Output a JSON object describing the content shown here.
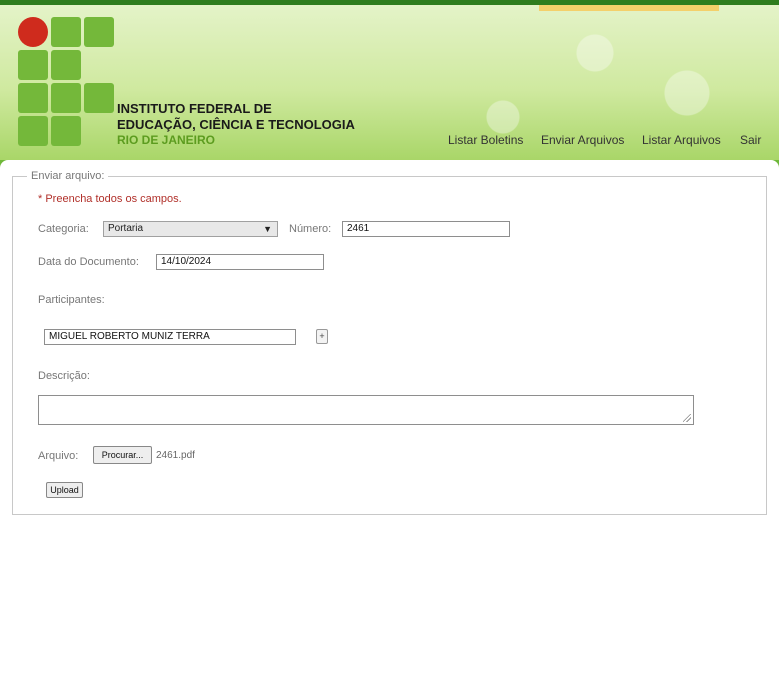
{
  "header": {
    "institution_line1": "INSTITUTO FEDERAL DE",
    "institution_line2": "EDUCAÇÃO, CIÊNCIA E TECNOLOGIA",
    "institution_line3": "RIO DE JANEIRO"
  },
  "nav": {
    "items": [
      {
        "label": "Listar Boletins"
      },
      {
        "label": "Enviar Arquivos"
      },
      {
        "label": "Listar Arquivos"
      },
      {
        "label": "Sair"
      }
    ]
  },
  "form": {
    "legend": "Enviar arquivo:",
    "error": "* Preencha todos os campos.",
    "categoria_label": "Categoria:",
    "categoria_value": "Portaria",
    "numero_label": "Número:",
    "numero_value": "2461",
    "data_label": "Data do Documento:",
    "data_value": "14/10/2024",
    "participantes_label": "Participantes:",
    "participante_value": "MIGUEL ROBERTO MUNIZ TERRA",
    "add_participant": "+",
    "descricao_label": "Descrição:",
    "descricao_value": "",
    "arquivo_label": "Arquivo:",
    "browse_label": "Procurar...",
    "file_name": "2461.pdf",
    "upload_label": "Upload"
  },
  "colors": {
    "brand_green": "#74b83a",
    "brand_red": "#cf2b1d",
    "error_red": "#b1302a"
  }
}
